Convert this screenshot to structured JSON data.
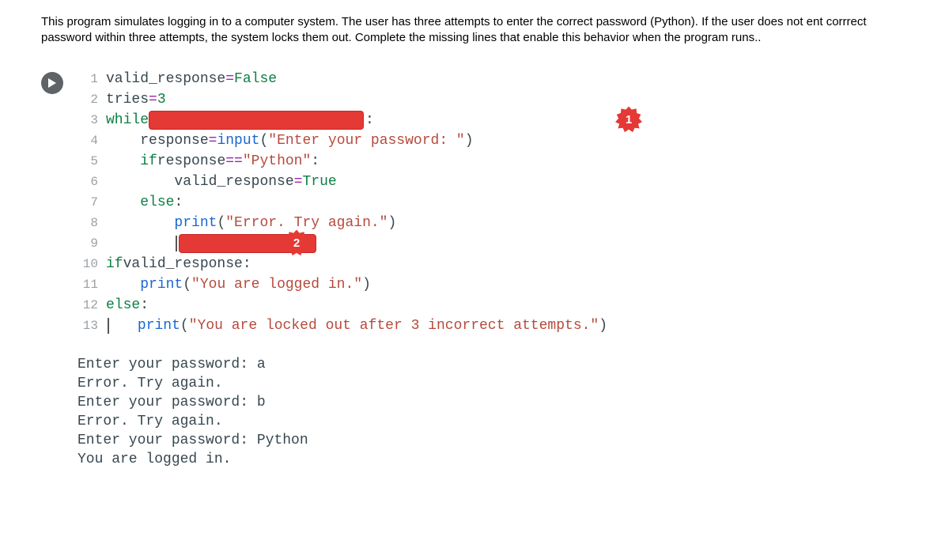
{
  "instructions": "This program simulates logging in to a computer system. The user has three attempts to enter the correct password (Python). If the user does not ent corrrect password within three attempts, the system locks them out.  Complete the missing lines that enable this behavior when the program runs..",
  "code": {
    "lines": [
      {
        "n": "1",
        "parts": [
          "valid_response ",
          "=",
          " ",
          "False"
        ]
      },
      {
        "n": "2",
        "parts": [
          "tries",
          "=",
          " ",
          "3"
        ]
      },
      {
        "n": "3",
        "parts": [
          "while "
        ],
        "blank": 1,
        "after": ":"
      },
      {
        "n": "4",
        "parts": [
          "    response ",
          "=",
          " ",
          "input",
          "(",
          "\"Enter your password: \"",
          ")"
        ]
      },
      {
        "n": "5",
        "parts": [
          "    ",
          "if",
          " response ",
          "==",
          " ",
          "\"Python\"",
          ":"
        ]
      },
      {
        "n": "6",
        "parts": [
          "        valid_response ",
          "=",
          " ",
          "True"
        ]
      },
      {
        "n": "7",
        "parts": [
          "    ",
          "else",
          ":"
        ]
      },
      {
        "n": "8",
        "parts": [
          "        ",
          "print",
          "(",
          "\"Error. Try again.\"",
          ")"
        ]
      },
      {
        "n": "9",
        "parts": [
          "        "
        ],
        "blank": 2
      },
      {
        "n": "10",
        "parts": [
          "if",
          " valid_response:"
        ]
      },
      {
        "n": "11",
        "parts": [
          "    ",
          "print",
          "(",
          "\"You are logged in.\"",
          ")"
        ]
      },
      {
        "n": "12",
        "parts": [
          "else",
          ":"
        ]
      },
      {
        "n": "13",
        "parts": [
          "    ",
          "print",
          "(",
          "\"You are locked out after 3 incorrect attempts.\"",
          ")"
        ]
      }
    ],
    "badges": {
      "1": "1",
      "2": "2"
    }
  },
  "output_lines": [
    "Enter your password: a",
    "Error. Try again.",
    "Enter your password: b",
    "Error. Try again.",
    "Enter your password: Python",
    "You are logged in."
  ]
}
